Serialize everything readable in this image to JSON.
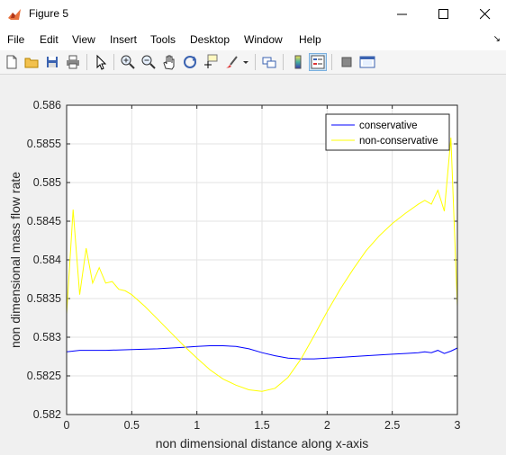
{
  "window": {
    "title": "Figure 5",
    "minimize_icon": "minimize-icon",
    "maximize_icon": "maximize-icon",
    "close_icon": "close-icon"
  },
  "menu": {
    "items": [
      "File",
      "Edit",
      "View",
      "Insert",
      "Tools",
      "Desktop",
      "Window",
      "Help"
    ]
  },
  "toolbar": {
    "icons": [
      "new-figure-icon",
      "open-file-icon",
      "save-icon",
      "print-icon",
      "edit-plot-arrow-icon",
      "zoom-in-icon",
      "zoom-out-icon",
      "pan-hand-icon",
      "rotate-3d-icon",
      "data-cursor-icon",
      "brush-icon",
      "link-plot-icon",
      "colorbar-icon",
      "legend-icon",
      "hide-plot-tools-icon",
      "show-plot-tools-icon"
    ]
  },
  "colors": {
    "conservative": "#0000ff",
    "non_conservative": "#ffff00"
  },
  "chart_data": {
    "type": "line",
    "xlabel": "non dimensional distance along x-axis",
    "ylabel": "non dimensional mass flow rate",
    "xlim": [
      0,
      3
    ],
    "ylim": [
      0.582,
      0.586
    ],
    "xticks": [
      "0",
      "0.5",
      "1",
      "1.5",
      "2",
      "2.5",
      "3"
    ],
    "yticks": [
      "0.582",
      "0.5825",
      "0.583",
      "0.5835",
      "0.584",
      "0.5845",
      "0.585",
      "0.5855",
      "0.586"
    ],
    "grid": true,
    "legend_location": "top-right",
    "series": [
      {
        "name": "conservative",
        "x": [
          0,
          0.1,
          0.2,
          0.3,
          0.5,
          0.7,
          0.9,
          1.0,
          1.1,
          1.2,
          1.3,
          1.4,
          1.5,
          1.6,
          1.7,
          1.8,
          1.9,
          2.0,
          2.1,
          2.2,
          2.3,
          2.4,
          2.5,
          2.6,
          2.7,
          2.75,
          2.8,
          2.85,
          2.9,
          2.95,
          3.0
        ],
        "y": [
          0.58281,
          0.58283,
          0.58283,
          0.58283,
          0.58284,
          0.58285,
          0.58287,
          0.58288,
          0.58289,
          0.58289,
          0.58288,
          0.58285,
          0.5828,
          0.58276,
          0.58273,
          0.58272,
          0.58272,
          0.58273,
          0.58274,
          0.58275,
          0.58276,
          0.58277,
          0.58278,
          0.58279,
          0.5828,
          0.58281,
          0.5828,
          0.58283,
          0.58279,
          0.58282,
          0.58286
        ]
      },
      {
        "name": "non-conservative",
        "x": [
          0,
          0.05,
          0.1,
          0.15,
          0.2,
          0.25,
          0.3,
          0.35,
          0.4,
          0.45,
          0.5,
          0.6,
          0.7,
          0.8,
          0.9,
          1.0,
          1.1,
          1.2,
          1.3,
          1.4,
          1.5,
          1.6,
          1.7,
          1.8,
          1.9,
          2.0,
          2.1,
          2.2,
          2.3,
          2.4,
          2.5,
          2.6,
          2.7,
          2.75,
          2.8,
          2.85,
          2.9,
          2.95,
          3.0
        ],
        "y": [
          0.5833,
          0.58465,
          0.58355,
          0.58415,
          0.5837,
          0.5839,
          0.5837,
          0.58372,
          0.58362,
          0.5836,
          0.58355,
          0.5834,
          0.58323,
          0.58306,
          0.58289,
          0.58273,
          0.58258,
          0.58246,
          0.58238,
          0.58232,
          0.5823,
          0.58234,
          0.58248,
          0.58272,
          0.58302,
          0.58333,
          0.58362,
          0.58388,
          0.58412,
          0.58431,
          0.58447,
          0.5846,
          0.58472,
          0.58477,
          0.58472,
          0.5849,
          0.58463,
          0.58558,
          0.5834
        ]
      }
    ]
  }
}
